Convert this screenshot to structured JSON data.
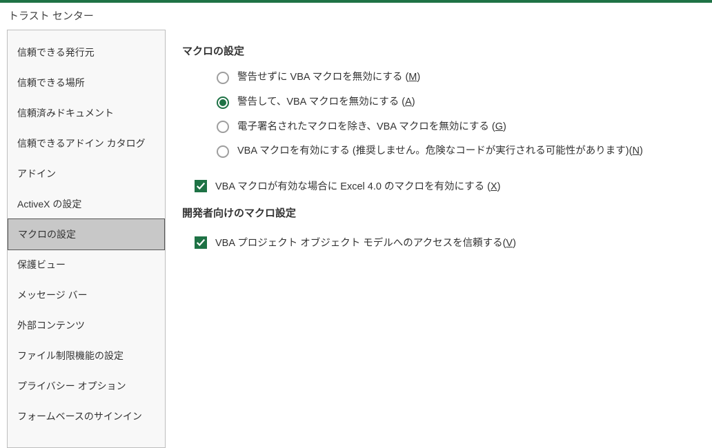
{
  "window": {
    "title": "トラスト センター"
  },
  "sidebar": {
    "items": [
      {
        "label": "信頼できる発行元"
      },
      {
        "label": "信頼できる場所"
      },
      {
        "label": "信頼済みドキュメント"
      },
      {
        "label": "信頼できるアドイン カタログ"
      },
      {
        "label": "アドイン"
      },
      {
        "label": "ActiveX の設定"
      },
      {
        "label": "マクロの設定"
      },
      {
        "label": "保護ビュー"
      },
      {
        "label": "メッセージ バー"
      },
      {
        "label": "外部コンテンツ"
      },
      {
        "label": "ファイル制限機能の設定"
      },
      {
        "label": "プライバシー オプション"
      },
      {
        "label": "フォームベースのサインイン"
      }
    ],
    "active_index": 6
  },
  "content": {
    "section1_heading": "マクロの設定",
    "radios": [
      {
        "text": "警告せずに VBA マクロを無効にする (",
        "mnemonic": "M",
        "suffix": ")",
        "checked": false
      },
      {
        "text": "警告して、VBA マクロを無効にする (",
        "mnemonic": "A",
        "suffix": ")",
        "checked": true
      },
      {
        "text": "電子署名されたマクロを除き、VBA マクロを無効にする (",
        "mnemonic": "G",
        "suffix": ")",
        "checked": false
      },
      {
        "text": "VBA マクロを有効にする (推奨しません。危険なコードが実行される可能性があります)(",
        "mnemonic": "N",
        "suffix": ")",
        "checked": false
      }
    ],
    "checkbox1": {
      "text": "VBA マクロが有効な場合に Excel 4.0 のマクロを有効にする (",
      "mnemonic": "X",
      "suffix": ")",
      "checked": true
    },
    "section2_heading": "開発者向けのマクロ設定",
    "checkbox2": {
      "text": "VBA プロジェクト オブジェクト モデルへのアクセスを信頼する(",
      "mnemonic": "V",
      "suffix": ")",
      "checked": true
    }
  }
}
